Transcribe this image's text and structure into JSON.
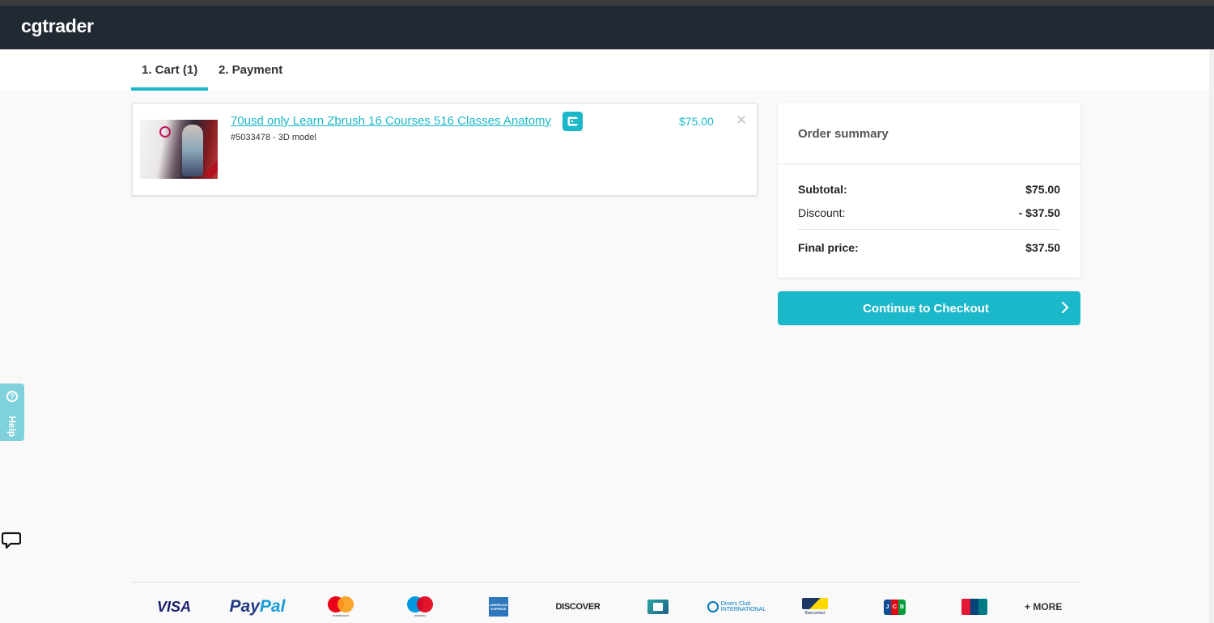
{
  "header": {
    "logo": "cgtrader"
  },
  "tabs": [
    {
      "label": "1. Cart (1)",
      "active": true
    },
    {
      "label": "2. Payment",
      "active": false
    }
  ],
  "cart": {
    "items": [
      {
        "title": "70usd only Learn Zbrush 16 Courses 516 Classes Anatomy",
        "meta": "#5033478 - 3D model",
        "price": "$75.00",
        "thumbnail_icon": "product-thumbnail",
        "badge_icon": "wallet-icon",
        "remove_icon": "close-icon"
      }
    ]
  },
  "summary": {
    "title": "Order summary",
    "subtotal_label": "Subtotal:",
    "subtotal_value": "$75.00",
    "discount_label": "Discount:",
    "discount_value": "- $37.50",
    "final_label": "Final price:",
    "final_value": "$37.50"
  },
  "checkout": {
    "label": "Continue to Checkout",
    "icon": "chevron-right-icon"
  },
  "help": {
    "label": "Help",
    "icon": "question-circle-icon"
  },
  "chat": {
    "icon": "chat-bubble-icon"
  },
  "payment_methods": {
    "visa": "VISA",
    "paypal_1": "Pay",
    "paypal_2": "Pal",
    "mastercard_caption": "mastercard",
    "maestro_caption": "maestro",
    "amex": "AMERICAN EXPRESS",
    "discover": "DISCOVER",
    "diners": "Diners Club INTERNATIONAL",
    "bancontact": "Bancontact",
    "jcb": [
      "J",
      "C",
      "B"
    ],
    "unionpay": "UnionPay",
    "more": "+ MORE"
  },
  "colors": {
    "accent": "#1bb8c9",
    "header_bg": "#212933",
    "page_bg": "#f9f9f9",
    "help_tab": "#7fd2dc"
  }
}
